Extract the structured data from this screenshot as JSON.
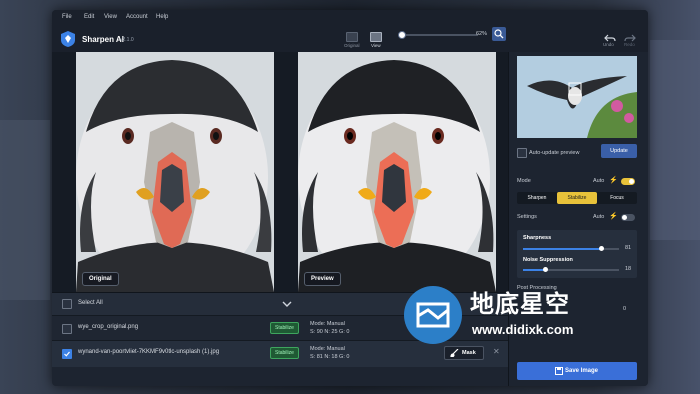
{
  "menu": [
    "File",
    "Edit",
    "View",
    "Account",
    "Help"
  ],
  "app": {
    "name": "Sharpen AI",
    "version": "v2.1.0"
  },
  "toolbar": {
    "original_label": "Original",
    "view_label": "View",
    "zoom": "62%",
    "undo_label": "Undo",
    "redo_label": "Redo"
  },
  "viewer": {
    "left_label": "Original",
    "right_label": "Preview"
  },
  "list": {
    "select_all": "Select All",
    "rows": [
      {
        "filename": "wye_crop_original.png",
        "badge": "Stabilize",
        "mode": "Mode: Manual",
        "values": "S: 90  N: 25  G: 0",
        "checked": false
      },
      {
        "filename": "wynand-van-poortvliet-7KKMF9v0tlc-unsplash (1).jpg",
        "badge": "Stabilize",
        "mode": "Mode: Manual",
        "values": "S: 81  N: 18  G: 0",
        "checked": true,
        "mask_label": "Mask"
      }
    ]
  },
  "side": {
    "auto_update": "Auto-update preview",
    "update": "Update",
    "mode_label": "Mode",
    "mode_auto": "Auto",
    "mode_tabs": [
      "Sharpen",
      "Stabilize",
      "Focus"
    ],
    "settings_label": "Settings",
    "settings_auto": "Auto",
    "sharpness_label": "Sharpness",
    "sharpness_value": "81",
    "noise_label": "Noise Suppression",
    "noise_value": "18",
    "post_label": "Post Processing",
    "post_value": "0",
    "save": "Save Image"
  },
  "watermark": {
    "title": "地底星空",
    "url": "www.didixk.com"
  },
  "colors": {
    "accent": "#3a6fd8",
    "stabilize": "#e8c23a",
    "badge_green": "#3ea55e"
  }
}
